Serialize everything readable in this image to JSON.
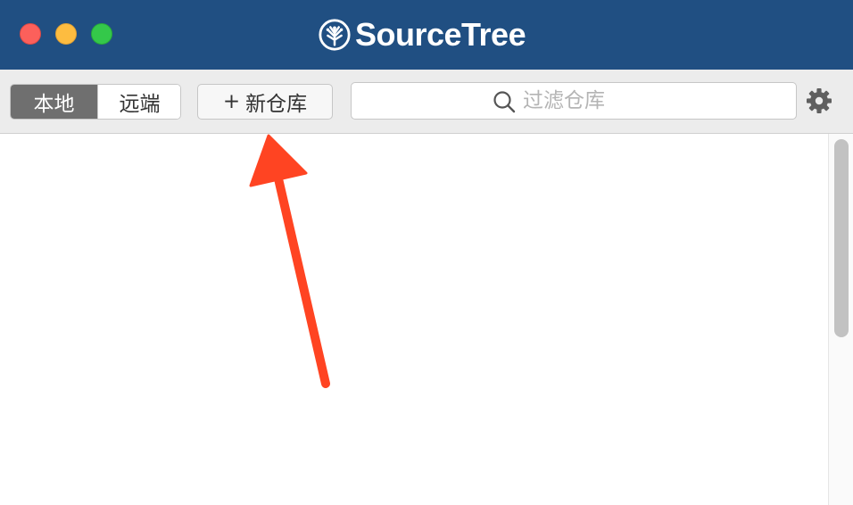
{
  "window": {
    "title": "SourceTree",
    "controls": [
      "close",
      "minimize",
      "zoom"
    ]
  },
  "toolbar": {
    "tabs": [
      {
        "label": "本地",
        "selected": true
      },
      {
        "label": "远端",
        "selected": false
      }
    ],
    "new_repo": {
      "plus": "+",
      "label": "新仓库"
    },
    "search": {
      "placeholder": "过滤仓库",
      "value": "",
      "icon": "search-icon"
    },
    "settings": {
      "icon": "gear-icon"
    }
  },
  "repository_list": {
    "items": []
  },
  "colors": {
    "titlebar": "#204f82",
    "selected_tab": "#6f6f6f",
    "annotation_arrow": "#ff4422"
  },
  "annotation": {
    "type": "arrow",
    "points_to": "new-repo-button"
  }
}
